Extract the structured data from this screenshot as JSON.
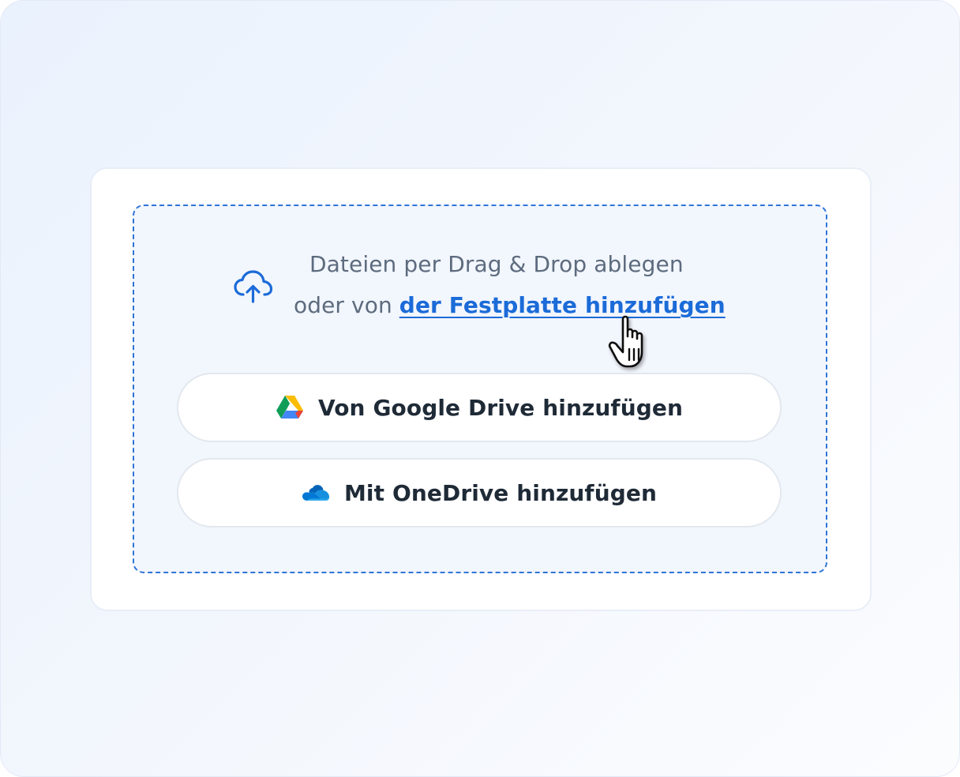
{
  "dropzone": {
    "line1": "Dateien per Drag & Drop ablegen",
    "line2_prefix": "oder von ",
    "link_label": "der Festplatte hinzufügen",
    "upload_icon": "cloud-upload-icon"
  },
  "buttons": {
    "google_drive_label": "Von Google Drive hinzufügen",
    "google_drive_icon": "google-drive-icon",
    "onedrive_label": "Mit OneDrive hinzufügen",
    "onedrive_icon": "onedrive-icon"
  },
  "cursor": {
    "icon": "hand-pointer-icon"
  },
  "colors": {
    "accent": "#1b6bd8",
    "dashed_border": "#2f74d8",
    "text_muted": "#5d6b7e",
    "text_dark": "#1f2a37"
  }
}
